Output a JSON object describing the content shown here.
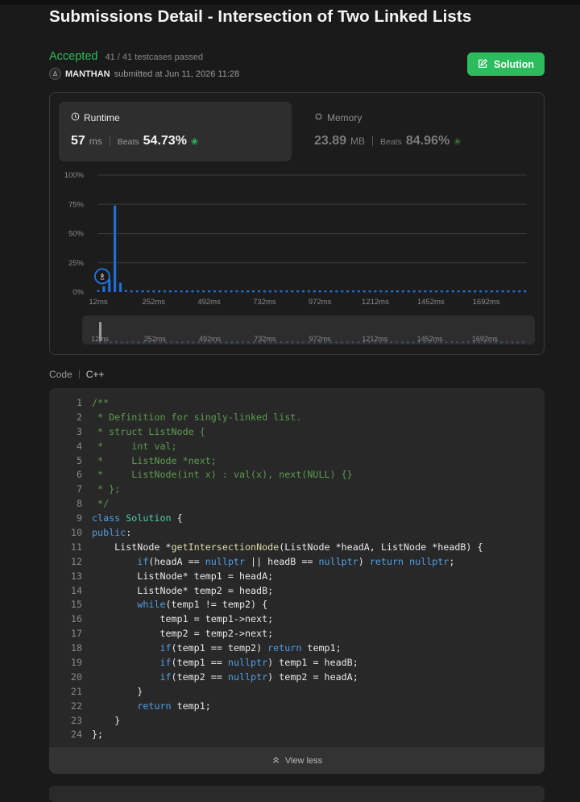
{
  "page": {
    "title": "Submissions Detail - Intersection of Two Linked Lists"
  },
  "submission": {
    "status": "Accepted",
    "testcases": "41 / 41 testcases passed",
    "author": "MANTHAN",
    "submitted_text": "submitted at Jun 11, 2026 11:28",
    "solution_label": "Solution"
  },
  "runtime": {
    "label": "Runtime",
    "value": "57",
    "unit": "ms",
    "beats_label": "Beats",
    "beats_pct": "54.73%"
  },
  "memory": {
    "label": "Memory",
    "value": "23.89",
    "unit": "MB",
    "beats_label": "Beats",
    "beats_pct": "84.96%"
  },
  "colors": {
    "accent_green": "#2cbb5d",
    "bar_blue": "#1f6fd6",
    "bar_muted": "#3d4d66"
  },
  "chart_data": {
    "type": "bar",
    "yticks": [
      "100%",
      "75%",
      "50%",
      "25%",
      "0%"
    ],
    "ylim": [
      0,
      100
    ],
    "xticks": [
      "12ms",
      "252ms",
      "492ms",
      "732ms",
      "972ms",
      "1212ms",
      "1452ms",
      "1692ms"
    ],
    "xlim": [
      12,
      1868
    ],
    "bin_ms": 24,
    "bars": [
      {
        "x": 12,
        "y": 1.5
      },
      {
        "x": 36,
        "y": 5
      },
      {
        "x": 60,
        "y": 11
      },
      {
        "x": 84,
        "y": 74
      },
      {
        "x": 108,
        "y": 8
      },
      {
        "x": 132,
        "y": 1.5
      }
    ],
    "baseline_pct": 1.5,
    "your_submission_ms": 57,
    "minimap_ticks": [
      "12ms",
      "252ms",
      "492ms",
      "732ms",
      "972ms",
      "1212ms",
      "1452ms",
      "1692ms"
    ]
  },
  "code": {
    "label": "Code",
    "language": "C++",
    "lines": [
      [
        [
          "cm",
          "/**"
        ]
      ],
      [
        [
          "cm",
          " * Definition for singly-linked list."
        ]
      ],
      [
        [
          "cm",
          " * struct ListNode {"
        ]
      ],
      [
        [
          "cm",
          " *     int val;"
        ]
      ],
      [
        [
          "cm",
          " *     ListNode *next;"
        ]
      ],
      [
        [
          "cm",
          " *     ListNode(int x) : val(x), next(NULL) {}"
        ]
      ],
      [
        [
          "cm",
          " * };"
        ]
      ],
      [
        [
          "cm",
          " */"
        ]
      ],
      [
        [
          "kw",
          "class "
        ],
        [
          "ty",
          "Solution"
        ],
        [
          "tx",
          " {"
        ]
      ],
      [
        [
          "kw",
          "public"
        ],
        [
          "tx",
          ":"
        ]
      ],
      [
        [
          "tx",
          "    ListNode *"
        ],
        [
          "fn",
          "getIntersectionNode"
        ],
        [
          "tx",
          "(ListNode *headA, ListNode *headB) {"
        ]
      ],
      [
        [
          "tx",
          "        "
        ],
        [
          "kw",
          "if"
        ],
        [
          "tx",
          "(headA == "
        ],
        [
          "kw",
          "nullptr"
        ],
        [
          "tx",
          " || headB == "
        ],
        [
          "kw",
          "nullptr"
        ],
        [
          "tx",
          ") "
        ],
        [
          "kw",
          "return"
        ],
        [
          "tx",
          " "
        ],
        [
          "kw",
          "nullptr"
        ],
        [
          "tx",
          ";"
        ]
      ],
      [
        [
          "tx",
          "        ListNode* temp1 = headA;"
        ]
      ],
      [
        [
          "tx",
          "        ListNode* temp2 = headB;"
        ]
      ],
      [
        [
          "tx",
          "        "
        ],
        [
          "kw",
          "while"
        ],
        [
          "tx",
          "(temp1 != temp2) {"
        ]
      ],
      [
        [
          "tx",
          "            temp1 = temp1->next;"
        ]
      ],
      [
        [
          "tx",
          "            temp2 = temp2->next;"
        ]
      ],
      [
        [
          "tx",
          "            "
        ],
        [
          "kw",
          "if"
        ],
        [
          "tx",
          "(temp1 == temp2) "
        ],
        [
          "kw",
          "return"
        ],
        [
          "tx",
          " temp1;"
        ]
      ],
      [
        [
          "tx",
          "            "
        ],
        [
          "kw",
          "if"
        ],
        [
          "tx",
          "(temp1 == "
        ],
        [
          "kw",
          "nullptr"
        ],
        [
          "tx",
          ") temp1 = headB;"
        ]
      ],
      [
        [
          "tx",
          "            "
        ],
        [
          "kw",
          "if"
        ],
        [
          "tx",
          "(temp2 == "
        ],
        [
          "kw",
          "nullptr"
        ],
        [
          "tx",
          ") temp2 = headA;"
        ]
      ],
      [
        [
          "tx",
          "        }"
        ]
      ],
      [
        [
          "tx",
          "        "
        ],
        [
          "kw",
          "return"
        ],
        [
          "tx",
          " temp1;"
        ]
      ],
      [
        [
          "tx",
          "    }"
        ]
      ],
      [
        [
          "tx",
          "};"
        ]
      ]
    ],
    "view_less_label": "View less"
  },
  "icons": {
    "runtime": "clock-icon",
    "memory": "chip-icon",
    "solution": "edit-icon",
    "beats": "leaf-bug-icon",
    "view_less": "chevrons-up-icon"
  }
}
